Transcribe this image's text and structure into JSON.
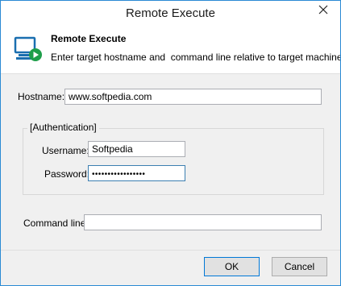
{
  "window": {
    "title": "Remote Execute"
  },
  "header": {
    "title": "Remote Execute",
    "description": "Enter target hostname and  command line relative to target machine.",
    "icon": "monitor-play-icon"
  },
  "form": {
    "hostname_label": "Hostname:",
    "hostname_value": "www.softpedia.com",
    "auth_group_title": "[Authentication]",
    "username_label": "Username:",
    "username_value": "Softpedia",
    "password_label": "Password:",
    "password_value": "•••••••••••••••••",
    "command_label": "Command line:",
    "command_value": ""
  },
  "buttons": {
    "ok": "OK",
    "cancel": "Cancel"
  },
  "colors": {
    "accent": "#0078d7",
    "window_border": "#2a8ad4",
    "icon_green": "#1e9e4a",
    "icon_blue": "#1a6fb0"
  }
}
